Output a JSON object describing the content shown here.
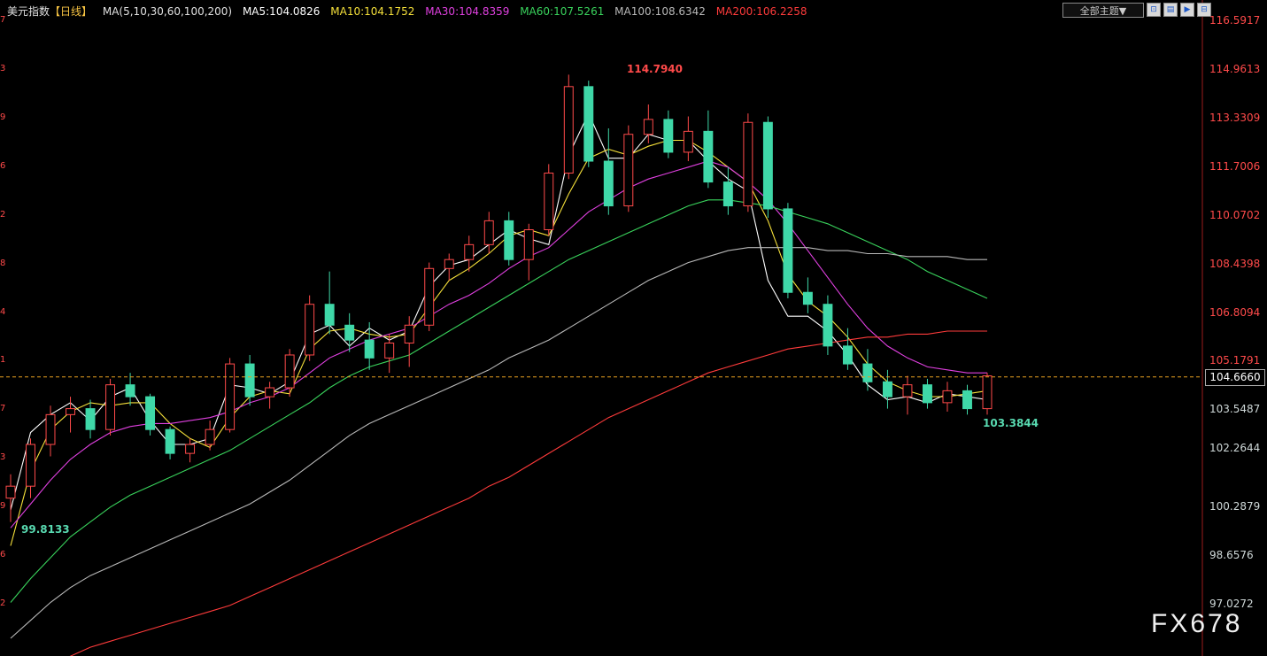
{
  "header": {
    "instrument": "美元指数",
    "period": "【日线】",
    "ma_spec": "MA(5,10,30,60,100,200)",
    "ma_values": [
      {
        "key": "MA5",
        "label": "MA5:104.0826",
        "color": "#ffffff"
      },
      {
        "key": "MA10",
        "label": "MA10:104.1752",
        "color": "#f5e03a"
      },
      {
        "key": "MA30",
        "label": "MA30:104.8359",
        "color": "#e040e0"
      },
      {
        "key": "MA60",
        "label": "MA60:107.5261",
        "color": "#39d35c"
      },
      {
        "key": "MA100",
        "label": "MA100:108.6342",
        "color": "#b8b8b8"
      },
      {
        "key": "MA200",
        "label": "MA200:106.2258",
        "color": "#ff3b3b"
      }
    ]
  },
  "toolbar": {
    "theme_label": "全部主题▼",
    "buttons": [
      "⊡",
      "▤",
      "▶",
      "⊟"
    ]
  },
  "axis_labels": [
    {
      "text": "116.5917",
      "value": 116.5917,
      "dir": "up"
    },
    {
      "text": "114.9613",
      "value": 114.9613,
      "dir": "up"
    },
    {
      "text": "113.3309",
      "value": 113.3309,
      "dir": "up"
    },
    {
      "text": "111.7006",
      "value": 111.7006,
      "dir": "up"
    },
    {
      "text": "110.0702",
      "value": 110.0702,
      "dir": "up"
    },
    {
      "text": "108.4398",
      "value": 108.4398,
      "dir": "up"
    },
    {
      "text": "106.8094",
      "value": 106.8094,
      "dir": "up"
    },
    {
      "text": "105.1791",
      "value": 105.1791,
      "dir": "up"
    },
    {
      "text": "103.5487",
      "value": 103.5487,
      "dir": "down"
    },
    {
      "text": "102.2644",
      "value": 102.2644,
      "dir": "down"
    },
    {
      "text": "100.2879",
      "value": 100.2879,
      "dir": "down"
    },
    {
      "text": "98.6576",
      "value": 98.6576,
      "dir": "down"
    },
    {
      "text": "97.0272",
      "value": 97.0272,
      "dir": "down"
    }
  ],
  "left_stubs": [
    {
      "text": "7",
      "value": 116.5917
    },
    {
      "text": "3",
      "value": 114.9613
    },
    {
      "text": "9",
      "value": 113.3309
    },
    {
      "text": "6",
      "value": 111.7006
    },
    {
      "text": "2",
      "value": 110.0702
    },
    {
      "text": "8",
      "value": 108.4398
    },
    {
      "text": "4",
      "value": 106.8094
    },
    {
      "text": "1",
      "value": 105.1791
    },
    {
      "text": "7",
      "value": 103.5487
    },
    {
      "text": "3",
      "value": 101.9183
    },
    {
      "text": "9",
      "value": 100.2879
    },
    {
      "text": "6",
      "value": 98.6576
    },
    {
      "text": "2",
      "value": 97.0272
    }
  ],
  "current_price": {
    "text": "104.6660",
    "value": 104.666
  },
  "annotations": {
    "high": {
      "text": "114.7940",
      "value": 114.794
    },
    "low_recent": {
      "text": "103.3844",
      "value": 103.3844
    },
    "low_start": {
      "text": "99.8133",
      "value": 99.8133
    }
  },
  "watermark": "FX678",
  "chart_data": {
    "type": "line",
    "title": "",
    "xlabel": "",
    "ylabel": "",
    "ylim": [
      96.0,
      117.0
    ],
    "grid": false,
    "series": [
      {
        "name": "MA5",
        "color": "#ffffff",
        "values": [
          100.2,
          102.8,
          103.4,
          103.8,
          103.2,
          104.0,
          104.3,
          103.2,
          102.4,
          102.4,
          102.6,
          104.4,
          104.3,
          104.1,
          104.5,
          106.1,
          106.4,
          105.7,
          106.3,
          105.9,
          106.2,
          107.7,
          108.4,
          108.6,
          109.1,
          109.6,
          109.3,
          109.1,
          112.1,
          113.5,
          112.0,
          112.0,
          112.8,
          112.6,
          112.6,
          111.9,
          111.3,
          110.9,
          107.9,
          106.7,
          106.7,
          106.2,
          105.4,
          104.4,
          103.9,
          104.0,
          103.8,
          104.1,
          104.0,
          103.9
        ]
      },
      {
        "name": "MA10",
        "color": "#f5e03a",
        "values": [
          99.0,
          101.5,
          102.9,
          103.5,
          103.8,
          103.7,
          103.8,
          103.8,
          103.1,
          102.6,
          102.3,
          103.3,
          104.0,
          104.2,
          104.1,
          105.6,
          106.2,
          106.3,
          106.1,
          106.0,
          106.1,
          107.0,
          107.9,
          108.3,
          108.8,
          109.4,
          109.6,
          109.4,
          110.8,
          112.0,
          112.3,
          112.1,
          112.4,
          112.6,
          112.6,
          112.2,
          111.7,
          111.2,
          109.9,
          108.1,
          107.2,
          106.7,
          106.0,
          105.1,
          104.5,
          104.2,
          104.0,
          104.0,
          104.1,
          104.2
        ]
      },
      {
        "name": "MA30",
        "color": "#e040e0",
        "values": [
          99.6,
          100.4,
          101.2,
          101.9,
          102.4,
          102.8,
          103.0,
          103.1,
          103.1,
          103.2,
          103.3,
          103.5,
          103.8,
          104.0,
          104.3,
          104.8,
          105.3,
          105.6,
          105.9,
          106.1,
          106.3,
          106.7,
          107.1,
          107.4,
          107.8,
          108.3,
          108.7,
          109.0,
          109.6,
          110.2,
          110.6,
          111.0,
          111.3,
          111.5,
          111.7,
          111.9,
          111.7,
          111.2,
          110.6,
          109.8,
          108.9,
          108.0,
          107.1,
          106.3,
          105.7,
          105.3,
          105.0,
          104.9,
          104.8,
          104.8
        ]
      },
      {
        "name": "MA60",
        "color": "#39d35c",
        "values": [
          97.1,
          97.9,
          98.6,
          99.3,
          99.8,
          100.3,
          100.7,
          101.0,
          101.3,
          101.6,
          101.9,
          102.2,
          102.6,
          103.0,
          103.4,
          103.8,
          104.3,
          104.7,
          105.0,
          105.2,
          105.4,
          105.8,
          106.2,
          106.6,
          107.0,
          107.4,
          107.8,
          108.2,
          108.6,
          108.9,
          109.2,
          109.5,
          109.8,
          110.1,
          110.4,
          110.6,
          110.6,
          110.5,
          110.4,
          110.2,
          110.0,
          109.8,
          109.5,
          109.2,
          108.9,
          108.6,
          108.2,
          107.9,
          107.6,
          107.3
        ]
      },
      {
        "name": "MA100",
        "color": "#b8b8b8",
        "values": [
          95.9,
          96.5,
          97.1,
          97.6,
          98.0,
          98.3,
          98.6,
          98.9,
          99.2,
          99.5,
          99.8,
          100.1,
          100.4,
          100.8,
          101.2,
          101.7,
          102.2,
          102.7,
          103.1,
          103.4,
          103.7,
          104.0,
          104.3,
          104.6,
          104.9,
          105.3,
          105.6,
          105.9,
          106.3,
          106.7,
          107.1,
          107.5,
          107.9,
          108.2,
          108.5,
          108.7,
          108.9,
          109.0,
          109.0,
          109.0,
          109.0,
          108.9,
          108.9,
          108.8,
          108.8,
          108.7,
          108.7,
          108.7,
          108.6,
          108.6
        ]
      },
      {
        "name": "MA200",
        "color": "#ff3b3b",
        "values": [
          94.4,
          94.7,
          95.0,
          95.3,
          95.6,
          95.8,
          96.0,
          96.2,
          96.4,
          96.6,
          96.8,
          97.0,
          97.3,
          97.6,
          97.9,
          98.2,
          98.5,
          98.8,
          99.1,
          99.4,
          99.7,
          100.0,
          100.3,
          100.6,
          101.0,
          101.3,
          101.7,
          102.1,
          102.5,
          102.9,
          103.3,
          103.6,
          103.9,
          104.2,
          104.5,
          104.8,
          105.0,
          105.2,
          105.4,
          105.6,
          105.7,
          105.8,
          105.9,
          106.0,
          106.0,
          106.1,
          106.1,
          106.2,
          106.2,
          106.2
        ]
      }
    ],
    "candles": [
      [
        100.6,
        101.4,
        99.8,
        101.0
      ],
      [
        101.0,
        102.6,
        100.6,
        102.4
      ],
      [
        102.4,
        103.7,
        102.0,
        103.4
      ],
      [
        103.4,
        104.0,
        102.8,
        103.6
      ],
      [
        103.6,
        103.9,
        102.6,
        102.9
      ],
      [
        102.9,
        104.6,
        102.7,
        104.4
      ],
      [
        104.4,
        104.8,
        103.7,
        104.0
      ],
      [
        104.0,
        104.1,
        102.7,
        102.9
      ],
      [
        102.9,
        103.0,
        101.9,
        102.1
      ],
      [
        102.1,
        102.6,
        101.8,
        102.4
      ],
      [
        102.4,
        103.2,
        102.2,
        102.9
      ],
      [
        102.9,
        105.3,
        102.8,
        105.1
      ],
      [
        105.1,
        105.4,
        103.7,
        104.0
      ],
      [
        104.0,
        104.5,
        103.6,
        104.3
      ],
      [
        104.3,
        105.6,
        104.0,
        105.4
      ],
      [
        105.4,
        107.4,
        105.2,
        107.1
      ],
      [
        107.1,
        108.2,
        106.1,
        106.4
      ],
      [
        106.4,
        106.8,
        105.5,
        105.9
      ],
      [
        105.9,
        106.5,
        104.9,
        105.3
      ],
      [
        105.3,
        106.1,
        104.8,
        105.8
      ],
      [
        105.8,
        106.7,
        105.0,
        106.4
      ],
      [
        106.4,
        108.5,
        106.2,
        108.3
      ],
      [
        108.3,
        108.8,
        107.9,
        108.6
      ],
      [
        108.6,
        109.4,
        108.2,
        109.1
      ],
      [
        109.1,
        110.2,
        108.8,
        109.9
      ],
      [
        109.9,
        110.2,
        108.4,
        108.6
      ],
      [
        108.6,
        109.8,
        107.9,
        109.6
      ],
      [
        109.6,
        111.8,
        109.4,
        111.5
      ],
      [
        111.5,
        114.8,
        111.3,
        114.4
      ],
      [
        114.4,
        114.6,
        111.7,
        111.9
      ],
      [
        111.9,
        113.0,
        110.1,
        110.4
      ],
      [
        110.4,
        113.1,
        110.2,
        112.8
      ],
      [
        112.8,
        113.8,
        112.5,
        113.3
      ],
      [
        113.3,
        113.6,
        112.0,
        112.2
      ],
      [
        112.2,
        113.4,
        111.9,
        112.9
      ],
      [
        112.9,
        113.6,
        111.0,
        111.2
      ],
      [
        111.2,
        111.7,
        110.1,
        110.4
      ],
      [
        110.4,
        113.5,
        110.2,
        113.2
      ],
      [
        113.2,
        113.4,
        110.0,
        110.3
      ],
      [
        110.3,
        110.5,
        107.3,
        107.5
      ],
      [
        107.5,
        108.0,
        106.8,
        107.1
      ],
      [
        107.1,
        107.4,
        105.4,
        105.7
      ],
      [
        105.7,
        106.3,
        104.9,
        105.1
      ],
      [
        105.1,
        105.6,
        104.2,
        104.5
      ],
      [
        104.5,
        104.9,
        103.6,
        104.0
      ],
      [
        104.0,
        104.7,
        103.4,
        104.4
      ],
      [
        104.4,
        104.6,
        103.6,
        103.8
      ],
      [
        103.8,
        104.5,
        103.5,
        104.2
      ],
      [
        104.2,
        104.4,
        103.4,
        103.6
      ],
      [
        103.6,
        104.8,
        103.4,
        104.7
      ]
    ]
  }
}
